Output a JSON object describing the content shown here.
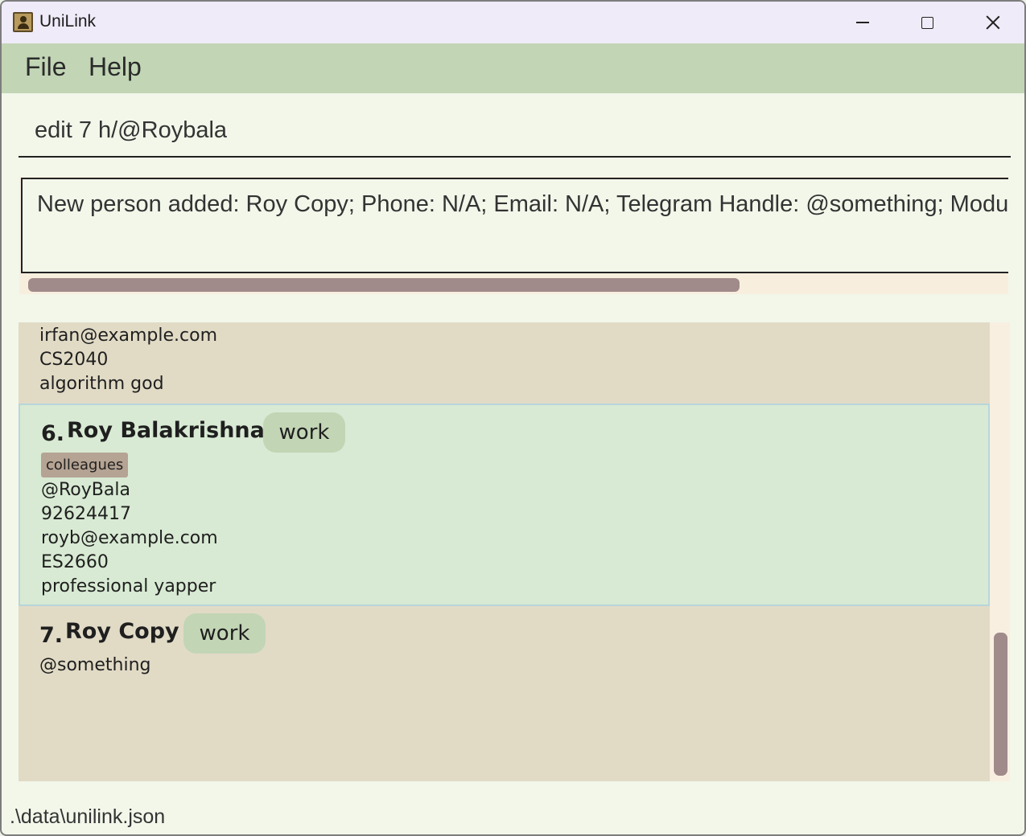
{
  "window": {
    "title": "UniLink",
    "icon": "contact-book-icon"
  },
  "menu": {
    "file": "File",
    "help": "Help"
  },
  "command": {
    "value": "edit 7 h/@Roybala"
  },
  "result": {
    "text": "New person added: Roy Copy; Phone: N/A; Email: N/A; Telegram Handle: @something; Module"
  },
  "persons": {
    "previous": {
      "email": "irfan@example.com",
      "module": "CS2040",
      "description": "algorithm god"
    },
    "selected": {
      "index": "6.",
      "name": "Roy Balakrishnan",
      "group_tag": "work",
      "tag": "colleagues",
      "telegram": "@RoyBala",
      "phone": "92624417",
      "email": "royb@example.com",
      "module": "ES2660",
      "description": "professional yapper"
    },
    "last": {
      "index": "7.",
      "name": "Roy Copy",
      "group_tag": "work",
      "telegram": "@something"
    }
  },
  "status": {
    "file_path": ".\\data\\unilink.json"
  },
  "colors": {
    "menubar": "#c2d5b5",
    "card": "#e1dbc6",
    "selected_card": "#d8ead3",
    "tag_work": "#c2d5b5",
    "tag_colleagues": "#b5a393",
    "scrollbar": "#a08a8a"
  }
}
